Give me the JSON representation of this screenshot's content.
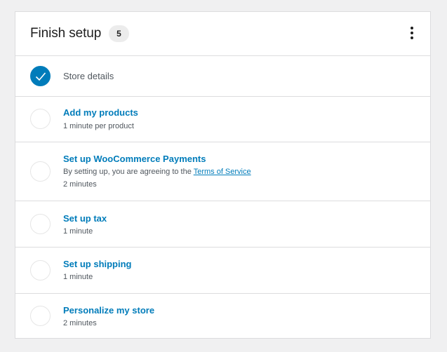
{
  "header": {
    "title": "Finish setup",
    "badge_count": "5",
    "menu_icon": "ellipsis-vertical-icon"
  },
  "tasks": [
    {
      "title": "Store details",
      "completed": true
    },
    {
      "title": "Add my products",
      "time": "1 minute per product",
      "completed": false
    },
    {
      "title": "Set up WooCommerce Payments",
      "description_prefix": "By setting up, you are agreeing to the ",
      "description_link": "Terms of Service",
      "time": "2 minutes",
      "completed": false
    },
    {
      "title": "Set up tax",
      "time": "1 minute",
      "completed": false
    },
    {
      "title": "Set up shipping",
      "time": "1 minute",
      "completed": false
    },
    {
      "title": "Personalize my store",
      "time": "2 minutes",
      "completed": false
    }
  ],
  "colors": {
    "accent": "#007cba",
    "text": "#1e1e1e",
    "muted": "#50575e",
    "border": "#dcdcde"
  }
}
